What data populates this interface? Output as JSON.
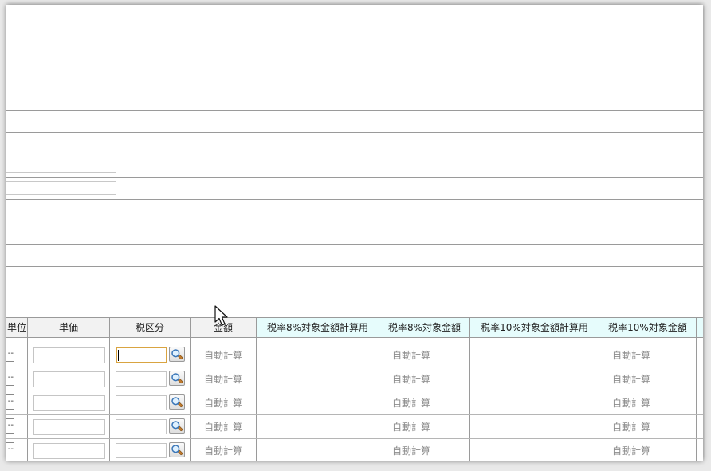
{
  "grid": {
    "headers": {
      "unit": "単位",
      "unit_price": "単価",
      "tax_category": "税区分",
      "amount": "金額",
      "tax8_calc": "税率8%対象金額計算用",
      "tax8_amount": "税率8%対象金額",
      "tax10_calc": "税率10%対象金額計算用",
      "tax10_amount": "税率10%対象金額"
    },
    "rows": [
      {
        "unit": "--",
        "amount": "自動計算",
        "tax8_amount": "自動計算",
        "tax10_amount": "自動計算"
      },
      {
        "unit": "--",
        "amount": "自動計算",
        "tax8_amount": "自動計算",
        "tax10_amount": "自動計算"
      },
      {
        "unit": "--",
        "amount": "自動計算",
        "tax8_amount": "自動計算",
        "tax10_amount": "自動計算"
      },
      {
        "unit": "--",
        "amount": "自動計算",
        "tax8_amount": "自動計算",
        "tax10_amount": "自動計算"
      },
      {
        "unit": "--",
        "amount": "自動計算",
        "tax8_amount": "自動計算",
        "tax10_amount": "自動計算"
      }
    ]
  },
  "icons": {
    "lookup": "magnifier-icon",
    "pointer": "mouse-pointer-icon"
  },
  "colors": {
    "header_gray": "#f2f2f2",
    "header_cyan": "#e6fcfc",
    "focus_border": "#d9a441",
    "placeholder_text": "#8c8c8c"
  }
}
